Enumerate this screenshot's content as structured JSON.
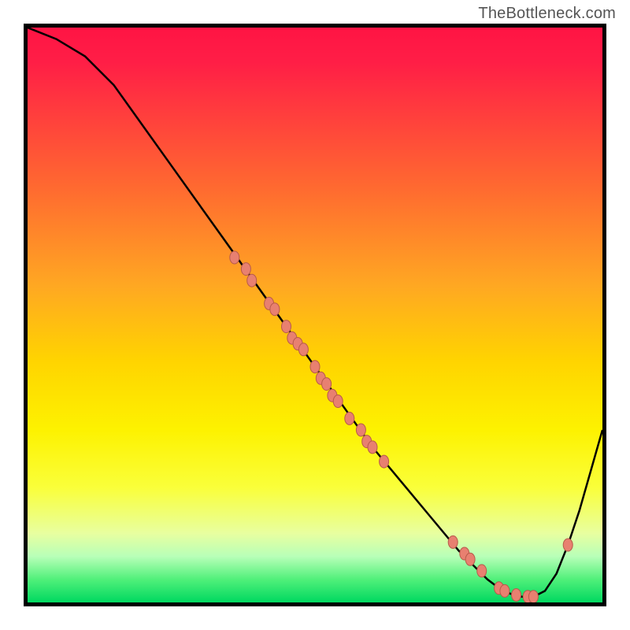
{
  "watermark": "TheBottleneck.com",
  "chart_data": {
    "type": "line",
    "title": "",
    "xlabel": "",
    "ylabel": "",
    "xlim": [
      0,
      100
    ],
    "ylim": [
      0,
      100
    ],
    "grid": false,
    "legend": false,
    "series": [
      {
        "name": "bottleneck-curve",
        "x": [
          0,
          5,
          10,
          15,
          20,
          25,
          30,
          35,
          40,
          45,
          50,
          55,
          60,
          65,
          70,
          75,
          78,
          80,
          82,
          84,
          86,
          88,
          90,
          92,
          94,
          96,
          98,
          100
        ],
        "y": [
          100,
          98,
          95,
          90,
          83,
          76,
          69,
          62,
          55,
          48,
          41,
          34,
          27,
          21,
          15,
          9,
          6,
          4,
          2.5,
          1.5,
          1,
          1,
          2,
          5,
          10,
          16,
          23,
          30
        ]
      }
    ],
    "scatter_points": {
      "name": "sampled-data-points",
      "x": [
        36,
        38,
        39,
        42,
        43,
        45,
        46,
        47,
        48,
        50,
        51,
        52,
        53,
        54,
        56,
        58,
        59,
        60,
        62,
        74,
        76,
        77,
        79,
        82,
        83,
        85,
        87,
        88,
        94
      ],
      "y": [
        60,
        58,
        56,
        52,
        51,
        48,
        46,
        45,
        44,
        41,
        39,
        38,
        36,
        35,
        32,
        30,
        28,
        27,
        24.5,
        10.5,
        8.5,
        7.5,
        5.5,
        2.5,
        2,
        1.3,
        1,
        1,
        10
      ]
    },
    "colors": {
      "curve": "#000000",
      "points_fill": "#e88070",
      "points_stroke": "#b85a4a",
      "gradient_top": "#ff1444",
      "gradient_mid": "#ffd400",
      "gradient_bottom": "#00d860"
    }
  }
}
